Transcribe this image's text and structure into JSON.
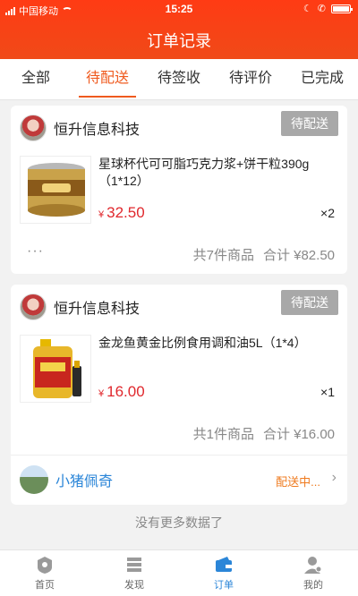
{
  "status_bar": {
    "carrier": "中国移动",
    "time": "15:25"
  },
  "header": {
    "title": "订单记录"
  },
  "tabs": [
    {
      "label": "全部",
      "active": false
    },
    {
      "label": "待配送",
      "active": true
    },
    {
      "label": "待签收",
      "active": false
    },
    {
      "label": "待评价",
      "active": false
    },
    {
      "label": "已完成",
      "active": false
    }
  ],
  "orders": [
    {
      "shop_name": "恒升信息科技",
      "status": "待配送",
      "product_name": "星球杯代可可脂巧克力浆+饼干粒390g（1*12）",
      "currency": "¥",
      "price": "32.50",
      "quantity": "×2",
      "more": "···",
      "count_text": "共7件商品",
      "total_text": "合计 ¥82.50"
    },
    {
      "shop_name": "恒升信息科技",
      "status": "待配送",
      "product_name": "金龙鱼黄金比例食用调和油5L（1*4）",
      "currency": "¥",
      "price": "16.00",
      "quantity": "×1",
      "count_text": "共1件商品",
      "total_text": "合计 ¥16.00",
      "courier_name": "小猪佩奇",
      "delivery_status": "配送中...",
      "chevron": "›"
    }
  ],
  "footer_text": "没有更多数据了",
  "nav": [
    {
      "label": "首页",
      "icon": "home-icon",
      "active": false
    },
    {
      "label": "发现",
      "icon": "discover-icon",
      "active": false
    },
    {
      "label": "订单",
      "icon": "order-icon",
      "active": true
    },
    {
      "label": "我的",
      "icon": "profile-icon",
      "active": false
    }
  ],
  "colors": {
    "brand": "#f04a18",
    "accent": "#ef5a1e",
    "price": "#e0282d",
    "link": "#2b86d8"
  }
}
